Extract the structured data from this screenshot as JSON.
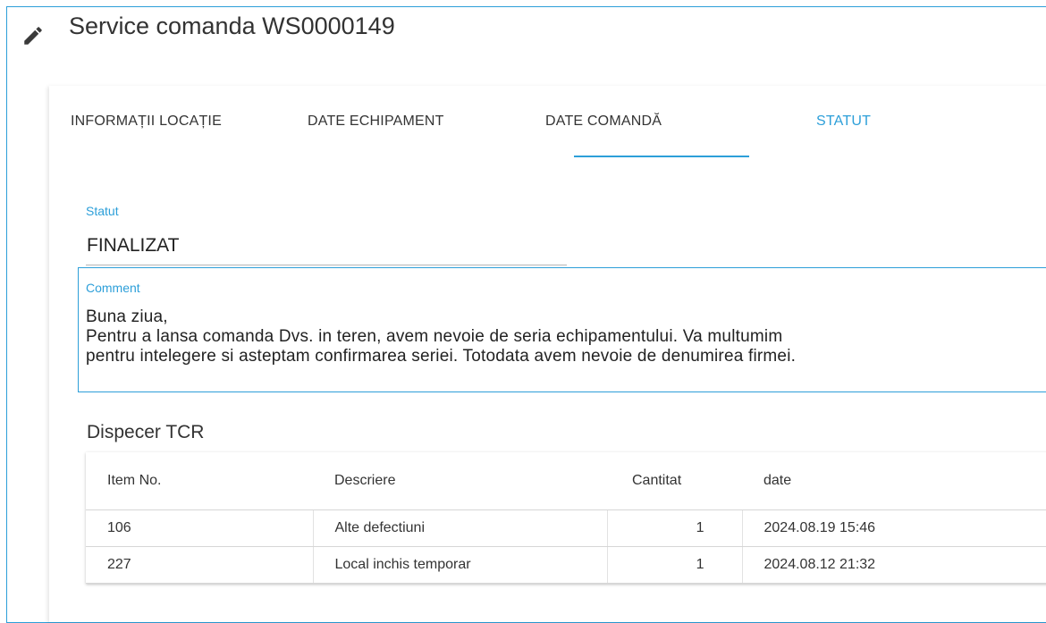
{
  "header": {
    "title": "Service comanda WS0000149",
    "icon": "pencil-icon"
  },
  "tabs": [
    {
      "label": "INFORMAȚII LOCAȚIE",
      "active": false
    },
    {
      "label": "DATE ECHIPAMENT",
      "active": false
    },
    {
      "label": "DATE COMANDĂ",
      "active": false
    },
    {
      "label": "STATUT",
      "active": true
    }
  ],
  "status_field": {
    "label": "Statut",
    "value": "FINALIZAT"
  },
  "comment_field": {
    "label": "Comment",
    "value": "Buna ziua,\nPentru a lansa comanda Dvs. in teren, avem nevoie de seria echipamentului. Va multumim\npentru intelegere si asteptam confirmarea seriei. Totodata avem nevoie de denumirea firmei."
  },
  "section": {
    "title": "Dispecer TCR"
  },
  "table": {
    "headers": [
      "Item No.",
      "Descriere",
      "Cantitat",
      "date"
    ],
    "rows": [
      [
        "106",
        "Alte defectiuni",
        "1",
        "2024.08.19 15:46"
      ],
      [
        "227",
        "Local inchis temporar",
        "1",
        "2024.08.12 21:32"
      ]
    ]
  },
  "colors": {
    "accent": "#2d9fd9",
    "text": "#212121",
    "divider": "#d6d6d6"
  }
}
